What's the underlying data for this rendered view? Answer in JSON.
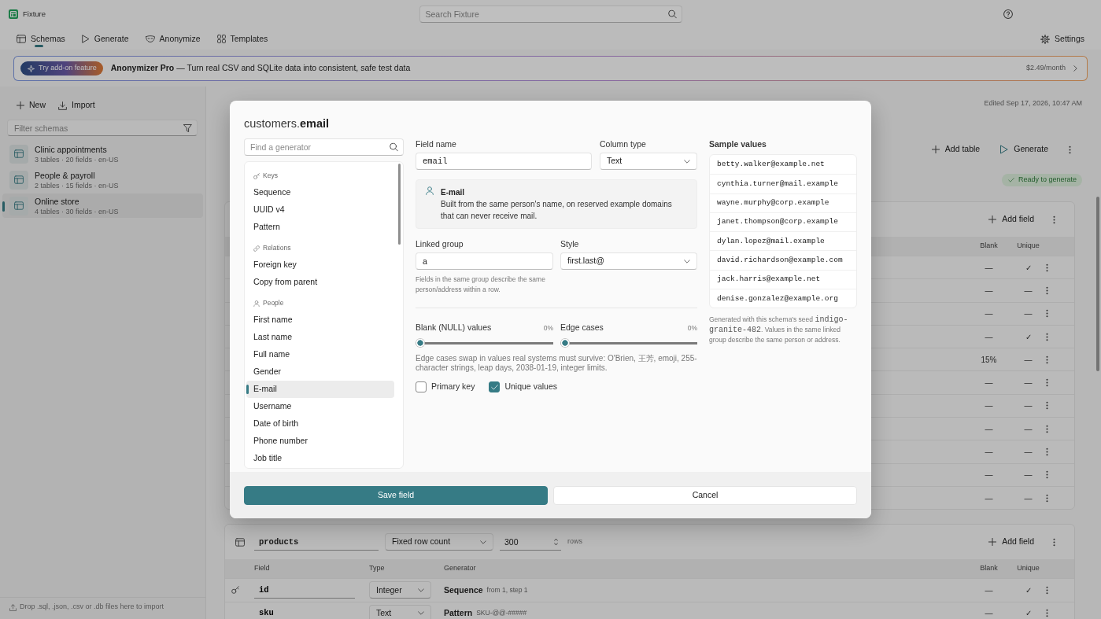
{
  "app": {
    "name": "Fixture"
  },
  "search": {
    "placeholder": "Search Fixture"
  },
  "nav_tabs": [
    {
      "label": "Schemas",
      "selected": true
    },
    {
      "label": "Generate",
      "selected": false
    },
    {
      "label": "Anonymize",
      "selected": false
    },
    {
      "label": "Templates",
      "selected": false
    }
  ],
  "settings": {
    "label": "Settings"
  },
  "banner": {
    "badge": "Try add-on feature",
    "text": "**Anonymizer Pro** — Turn real CSV and SQLite data into consistent, safe test data",
    "price": "$2.49/month"
  },
  "sidebar": {
    "actions": [
      {
        "label": "New"
      },
      {
        "label": "Import"
      }
    ],
    "filter": {
      "placeholder": "Filter schemas"
    },
    "schemas": [
      {
        "name": "Clinic appointments",
        "meta": "3 tables · 20 fields · en-US",
        "selected": false
      },
      {
        "name": "People & payroll",
        "meta": "2 tables · 15 fields · en-US",
        "selected": false
      },
      {
        "name": "Online store",
        "meta": "4 tables · 30 fields · en-US",
        "selected": true
      }
    ],
    "drop_hint": "Drop .sql, .json, .csv or .db files here to import"
  },
  "main": {
    "edited": "Edited Sep 17, 2026, 10:47 AM",
    "actions": [
      {
        "label": "Add table"
      },
      {
        "label": "Generate"
      }
    ],
    "status": "Ready to generate",
    "tables": [
      {
        "add_field": "Add field",
        "columns": [
          "Blank",
          "Unique"
        ],
        "rows": [
          {
            "blank": "—",
            "unique": "✓"
          },
          {
            "blank": "—",
            "unique": "—"
          },
          {
            "blank": "—",
            "unique": "—"
          },
          {
            "blank": "—",
            "unique": "✓"
          },
          {
            "blank": "15%",
            "unique": "—"
          },
          {
            "blank": "—",
            "unique": "—"
          },
          {
            "blank": "—",
            "unique": "—"
          },
          {
            "blank": "—",
            "unique": "—"
          },
          {
            "blank": "—",
            "unique": "—"
          },
          {
            "blank": "—",
            "unique": "—"
          },
          {
            "blank": "—",
            "unique": "—"
          }
        ]
      },
      {
        "name": "products",
        "row_mode": "Fixed row count",
        "row_count": "300",
        "row_unit": "rows",
        "add_field": "Add field",
        "columns": [
          "Field",
          "Type",
          "Generator",
          "Blank",
          "Unique"
        ],
        "rows": [
          {
            "key": true,
            "field": "id",
            "type": "Integer",
            "generator": "Sequence",
            "detail": "from 1, step 1",
            "blank": "—",
            "unique": "✓"
          },
          {
            "key": false,
            "field": "sku",
            "type": "Text",
            "generator": "Pattern",
            "detail": "SKU-@@-#####",
            "blank": "—",
            "unique": "✓"
          }
        ]
      }
    ]
  },
  "dialog": {
    "title": "customers.**email**",
    "generator_search": {
      "placeholder": "Find a generator"
    },
    "generator_groups": [
      {
        "label": "Keys",
        "items": [
          {
            "label": "Sequence",
            "selected": false
          },
          {
            "label": "UUID v4",
            "selected": false
          },
          {
            "label": "Pattern",
            "selected": false
          }
        ]
      },
      {
        "label": "Relations",
        "items": [
          {
            "label": "Foreign key",
            "selected": false
          },
          {
            "label": "Copy from parent",
            "selected": false
          }
        ]
      },
      {
        "label": "People",
        "items": [
          {
            "label": "First name",
            "selected": false
          },
          {
            "label": "Last name",
            "selected": false
          },
          {
            "label": "Full name",
            "selected": false
          },
          {
            "label": "Gender",
            "selected": false
          },
          {
            "label": "E-mail",
            "selected": true
          },
          {
            "label": "Username",
            "selected": false
          },
          {
            "label": "Date of birth",
            "selected": false
          },
          {
            "label": "Phone number",
            "selected": false
          },
          {
            "label": "Job title",
            "selected": false
          }
        ]
      }
    ],
    "field_name": {
      "label": "Field name",
      "value": "email"
    },
    "column_type": {
      "label": "Column type",
      "value": "Text"
    },
    "info": {
      "title": "E-mail",
      "text": "Built from the same person's name, on reserved example domains that can never receive mail."
    },
    "linked_group": {
      "label": "Linked group",
      "value": "a",
      "help": "Fields in the same group describe the same person/address within a row."
    },
    "style": {
      "label": "Style",
      "value": "first.last@"
    },
    "sliders": [
      {
        "label": "Blank (NULL) values",
        "reading": "0%",
        "level": 0
      },
      {
        "label": "Edge cases",
        "reading": "0%",
        "level": 0
      }
    ],
    "edge_help": "Edge cases swap in values real systems must survive: O'Brien, 王芳, emoji, 255-character strings, leap days, 2038-01-19, integer limits.",
    "checkboxes": [
      {
        "label": "Primary key",
        "checked": false
      },
      {
        "label": "Unique values",
        "checked": true
      }
    ],
    "samples": {
      "label": "Sample values",
      "values": [
        "betty.walker@example.net",
        "cynthia.turner@mail.example",
        "wayne.murphy@corp.example",
        "janet.thompson@corp.example",
        "dylan.lopez@mail.example",
        "david.richardson@example.com",
        "jack.harris@example.net",
        "denise.gonzalez@example.org"
      ]
    },
    "seed_note": {
      "before": "Generated with this schema's seed ",
      "seed": "indigo-granite-482",
      "after": ". Values in the same linked group describe the same person or address."
    },
    "buttons": [
      {
        "label": "Save field",
        "kind": "primary"
      },
      {
        "label": "Cancel",
        "kind": "secondary"
      }
    ]
  }
}
